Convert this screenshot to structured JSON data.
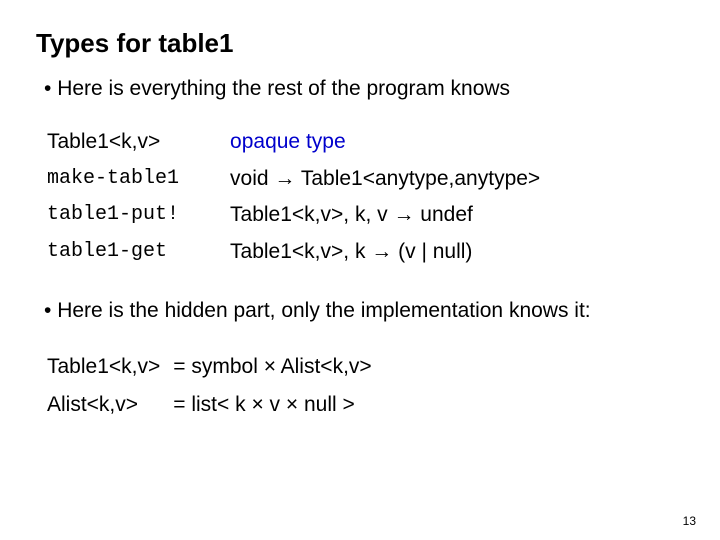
{
  "title": "Types for table1",
  "bullet1": "Here is everything the rest of the program knows",
  "types": {
    "r0": {
      "name": "Table1<k,v>",
      "desc_html": "<span class=\"blue\">opaque type</span>"
    },
    "r1": {
      "name": "make-table1",
      "desc_html": "void → Table1&lt;anytype,anytype&gt;"
    },
    "r2": {
      "name": "table1-put!",
      "desc_html": "Table1&lt;k,v&gt;, k, v → undef"
    },
    "r3": {
      "name": "table1-get",
      "desc_html": "Table1&lt;k,v&gt;, k → (v | null)"
    }
  },
  "bullet2": "Here is the hidden part, only the implementation knows it:",
  "hidden": {
    "r0": {
      "lhs": "Table1<k,v>",
      "rhs": "= symbol × Alist<k,v>"
    },
    "r1": {
      "lhs": "Alist<k,v>",
      "rhs": "= list< k × v × null >"
    }
  },
  "page": "13"
}
